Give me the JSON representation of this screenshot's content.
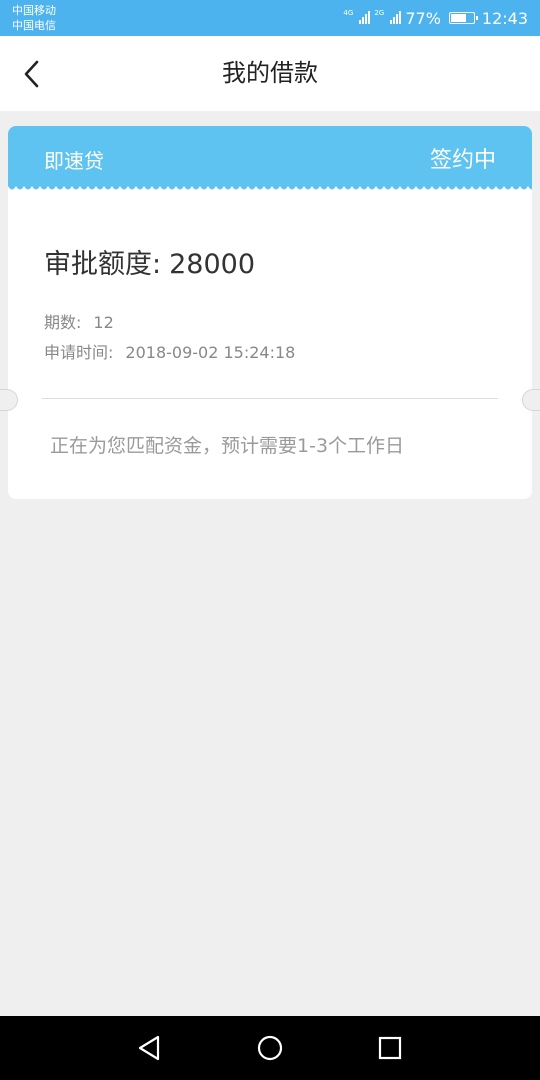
{
  "status_bar": {
    "carrier_1": "中国移动",
    "carrier_2": "中国电信",
    "net_1": "4G",
    "net_2": "2G",
    "battery": "77%",
    "battery_level": 0.77,
    "time": "12:43"
  },
  "header": {
    "title": "我的借款",
    "back_icon": "chevron-left-icon"
  },
  "loan_card": {
    "product_name": "即速贷",
    "status": "签约中",
    "approved_label": "审批额度:",
    "approved_amount": "28000",
    "periods_label": "期数:",
    "periods_value": "12",
    "apply_time_label": "申请时间:",
    "apply_time_value": "2018-09-02 15:24:18",
    "progress_note": "正在为您匹配资金，预计需要1-3个工作日"
  },
  "nav_bar": {
    "back_icon": "triangle-back-icon",
    "home_icon": "circle-home-icon",
    "recents_icon": "square-recents-icon"
  },
  "colors": {
    "status_bar": "#4db3ef",
    "card_header": "#5ec3f1",
    "background": "#efefef"
  }
}
